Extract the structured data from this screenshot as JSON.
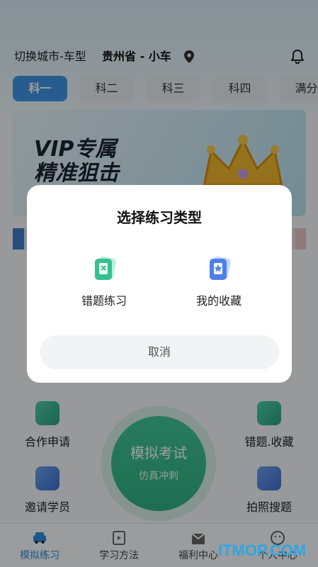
{
  "header": {
    "city_switch_label": "切换城市-车型",
    "city_value": "贵州省 - 小车"
  },
  "tabs": [
    "科一",
    "科二",
    "科三",
    "科四",
    "满分"
  ],
  "banner": {
    "title_line1": "VIP专属",
    "title_line2": "精准狙击"
  },
  "functions": {
    "cooperation": "合作申请",
    "mistakes_favorites": "错题.收藏",
    "invite": "邀请学员",
    "photo_search": "拍照搜题"
  },
  "exam_button": {
    "title": "模拟考试",
    "subtitle": "仿真冲刺"
  },
  "bottom_nav": [
    {
      "label": "模拟练习"
    },
    {
      "label": "学习方法"
    },
    {
      "label": "福利中心"
    },
    {
      "label": "个人中心"
    }
  ],
  "dialog": {
    "title": "选择练习类型",
    "option_mistakes": "错题练习",
    "option_favorites": "我的收藏",
    "cancel": "取消"
  },
  "watermark": "ITMOP.COM",
  "colors": {
    "accent": "#3f96e6",
    "exam_green": "#2fb184",
    "watermark": "#2ea6e6"
  }
}
